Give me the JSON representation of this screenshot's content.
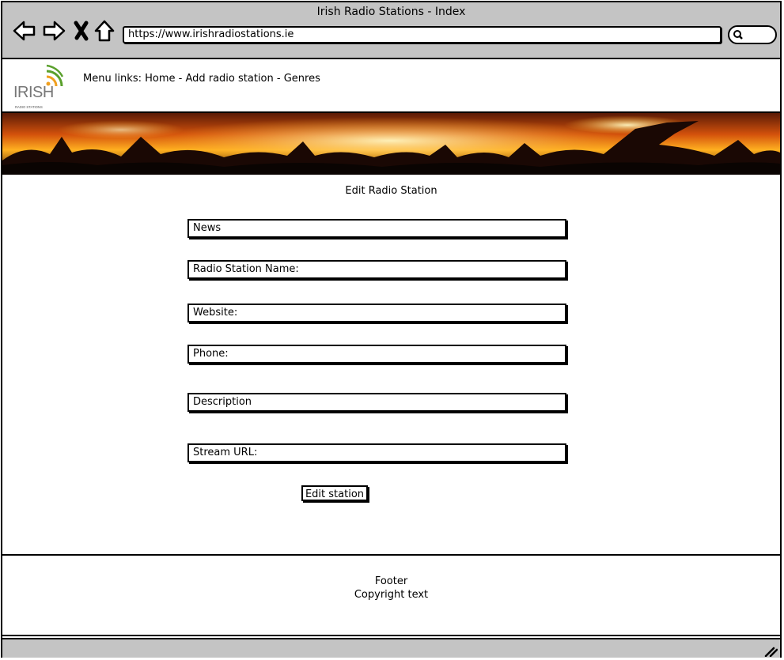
{
  "window": {
    "title": "Irish Radio Stations - Index",
    "url": "https://www.irishradiostations.ie"
  },
  "header": {
    "logo_text": "IRISH",
    "logo_subtext": "RADIO STATIONS",
    "menu_text": "Menu links: Home - Add radio station - Genres"
  },
  "form": {
    "title": "Edit Radio Station",
    "fields": [
      "News",
      "Radio Station Name:",
      "Website:",
      "Phone:",
      "Description",
      "Stream URL:"
    ],
    "submit_label": "Edit station"
  },
  "footer": {
    "line1": "Footer",
    "line2": "Copyright text"
  },
  "colors": {
    "chrome_gray": "#c4c4c4",
    "logo_accent_green": "#5aa02c",
    "logo_accent_orange": "#f0a020"
  }
}
